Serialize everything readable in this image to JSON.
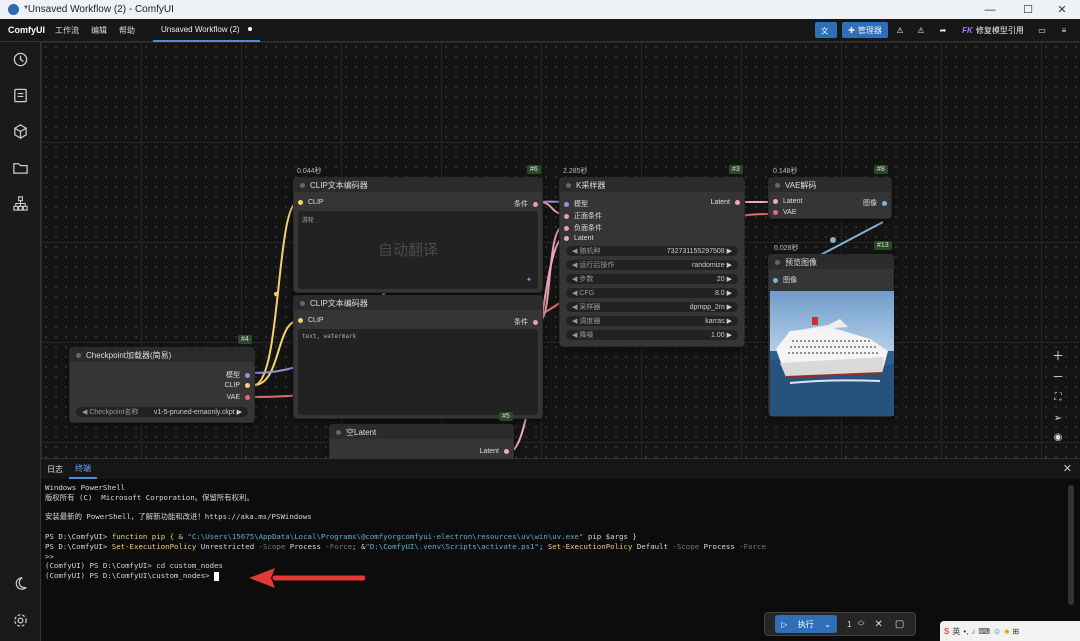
{
  "window": {
    "title": "*Unsaved Workflow (2) - ComfyUI",
    "minimize": "—",
    "maximize": "☐",
    "close": "✕"
  },
  "menubar": {
    "logo": "ComfyUI",
    "items": [
      "工作流",
      "编辑",
      "帮助"
    ],
    "tab": "Unsaved Workflow (2)",
    "translate_icon": "translate-icon",
    "manager_label": "管理器",
    "fix_models_label": "修复模型引用",
    "fk_prefix": "FK"
  },
  "sidebar": {
    "icons": [
      "history-icon",
      "queue-icon",
      "node-library-icon",
      "model-library-icon",
      "workflow-icon"
    ],
    "bottom_icons": [
      "theme-icon",
      "settings-icon"
    ]
  },
  "nodes": {
    "clip1": {
      "time": "0.044秒",
      "id": "#6",
      "title": "CLIP文本编码器",
      "in": "CLIP",
      "out": "条件",
      "text": "游轮",
      "overlay": "自动翻译"
    },
    "clip2": {
      "title": "CLIP文本编码器",
      "in": "CLIP",
      "out": "条件",
      "text": "text, watermark"
    },
    "ksampler": {
      "time": "2.285秒",
      "id": "#3",
      "title": "K采样器",
      "inputs": [
        "模型",
        "正面条件",
        "负面条件",
        "Latent"
      ],
      "output": "Latent",
      "widgets": [
        {
          "label": "随机种",
          "value": "732731155297508"
        },
        {
          "label": "运行后操作",
          "value": "randomize"
        },
        {
          "label": "步数",
          "value": "20"
        },
        {
          "label": "CFG",
          "value": "8.0"
        },
        {
          "label": "采样器",
          "value": "dpmpp_2m"
        },
        {
          "label": "调度器",
          "value": "karras"
        },
        {
          "label": "降噪",
          "value": "1.00"
        }
      ]
    },
    "vae": {
      "time": "0.148秒",
      "id": "#8",
      "title": "VAE解码",
      "inputs": [
        "Latent",
        "VAE"
      ],
      "output": "图像"
    },
    "preview": {
      "time": "0.028秒",
      "id": "#13",
      "title": "预览图像",
      "input": "图像"
    },
    "checkpoint": {
      "id": "#4",
      "title": "Checkpoint加载器(简易)",
      "outputs": [
        "模型",
        "CLIP",
        "VAE"
      ],
      "widget_label": "Checkpoint名称",
      "widget_value": "v1-5-pruned-emaonly.ckpt"
    },
    "latent": {
      "id": "#5",
      "title": "空Latent",
      "output": "Latent"
    }
  },
  "panel": {
    "tabs": [
      "日志",
      "终端"
    ],
    "terminal": {
      "l1": "Windows PowerShell",
      "l2": "版权所有 (C)  Microsoft Corporation。保留所有权利。",
      "l3": "安装最新的 PowerShell，了解新功能和改进！https://aka.ms/PSWindows",
      "l4a": "PS D:\\ComfyUI> ",
      "l4b": "function pip { & ",
      "l4c": "\"C:\\Users\\15675\\AppData\\Local\\Programs\\@comfyorgcomfyui-electron\\resources\\uv\\win\\uv.exe\"",
      "l4d": " pip $args }",
      "l5a": "PS D:\\ComfyUI> ",
      "l5b": "Set-ExecutionPolicy",
      "l5c": " Unrestricted ",
      "l5d": "-Scope",
      "l5e": " Process ",
      "l5f": "-Force",
      "l5g": "; &",
      "l5h": "\"D:\\ComfyUI\\.venv\\Scripts\\activate.ps1\"",
      "l5i": "; ",
      "l5j": "Set-ExecutionPolicy",
      "l5k": " Default ",
      "l5l": "-Scope",
      "l5m": " Process ",
      "l5n": "-Force",
      "l6": ">>",
      "l7a": "(ComfyUI) PS D:\\ComfyUI> ",
      "l7b": "cd",
      "l7c": " custom_nodes",
      "l8": "(ComfyUI) PS D:\\ComfyUI\\custom_nodes> "
    }
  },
  "runbar": {
    "run_label": "执行",
    "count": "1"
  },
  "taskbar": {
    "ime": "英"
  },
  "colors": {
    "accent": "#2f6fb8",
    "arrow": "#e53935",
    "clip_wire": "#f5d26b",
    "vae_wire": "#e06c75",
    "cond_wire": "#e8a0a0",
    "latent_wire": "#f5a5c8",
    "image_wire": "#7fb3d5"
  }
}
